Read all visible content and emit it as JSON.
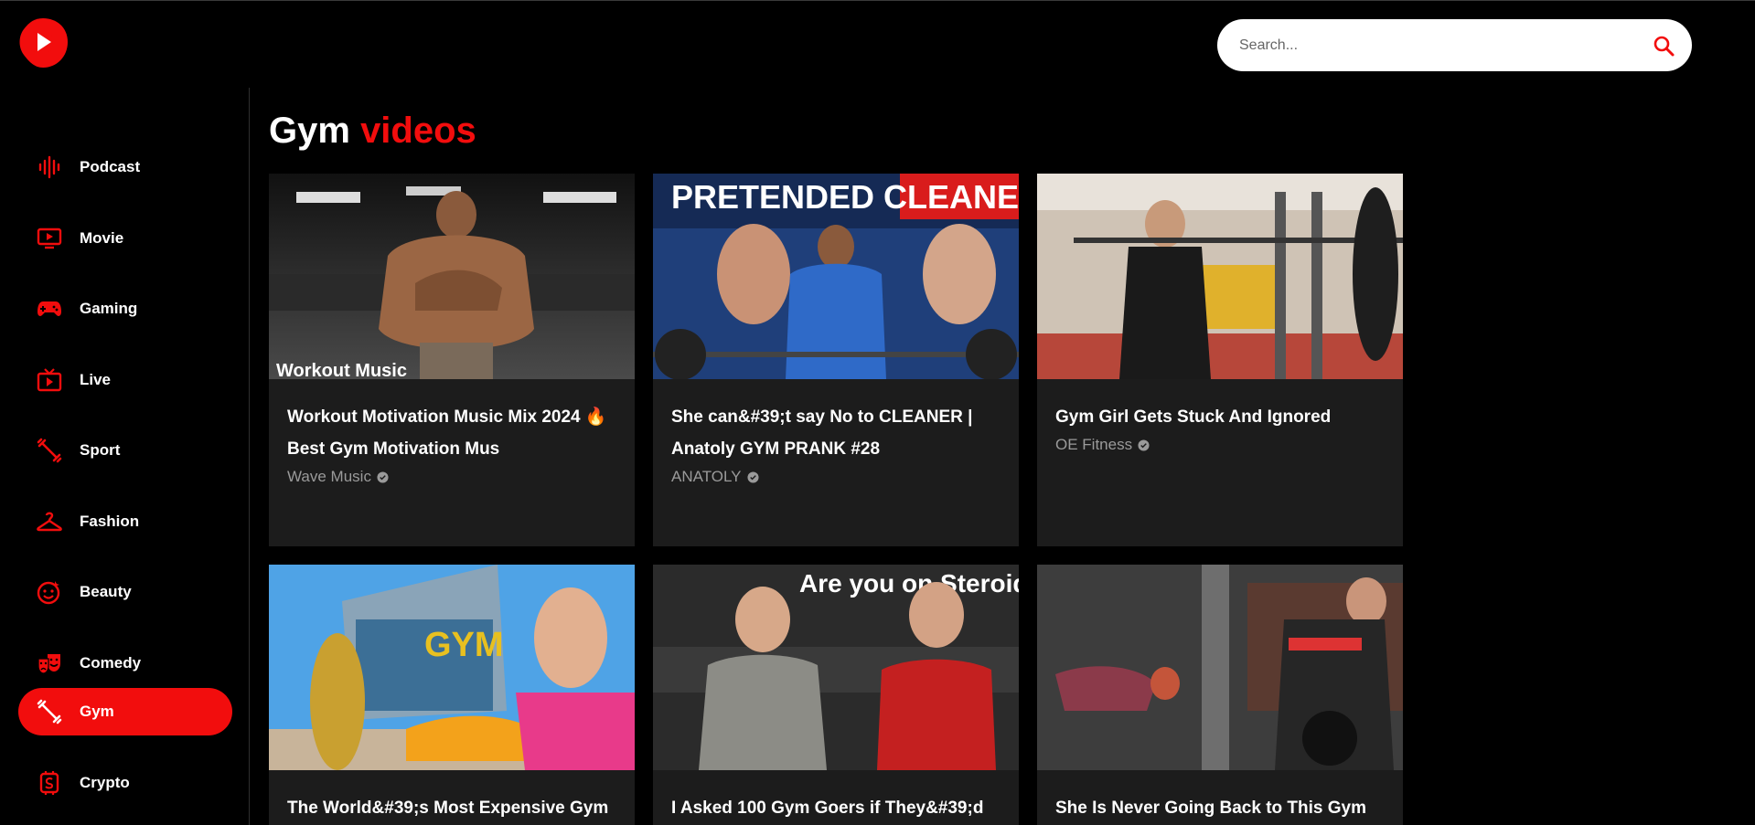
{
  "app": {
    "search_placeholder": "Search..."
  },
  "sidebar": {
    "items": [
      {
        "label": "Podcast",
        "icon": "podcast-icon",
        "active": false
      },
      {
        "label": "Movie",
        "icon": "movie-icon",
        "active": false
      },
      {
        "label": "Gaming",
        "icon": "gamepad-icon",
        "active": false
      },
      {
        "label": "Live",
        "icon": "live-tv-icon",
        "active": false
      },
      {
        "label": "Sport",
        "icon": "sport-icon",
        "active": false
      },
      {
        "label": "Fashion",
        "icon": "hanger-icon",
        "active": false
      },
      {
        "label": "Beauty",
        "icon": "beauty-icon",
        "active": false
      },
      {
        "label": "Comedy",
        "icon": "comedy-masks-icon",
        "active": false
      },
      {
        "label": "Gym",
        "icon": "dumbbell-icon",
        "active": true
      },
      {
        "label": "Crypto",
        "icon": "crypto-icon",
        "active": false
      }
    ]
  },
  "main": {
    "heading_primary": "Gym",
    "heading_accent": "videos",
    "videos": [
      {
        "title": "Workout Motivation Music Mix 2024 🔥 Best Gym Motivation Mus",
        "channel": "Wave Music",
        "verified": true,
        "thumb_text": "Workout Music"
      },
      {
        "title": "She can&#39;t say No to CLEANER | Anatoly GYM PRANK #28",
        "channel": "ANATOLY",
        "verified": true,
        "thumb_text": "PRETENDED CLEANER IN A GYM"
      },
      {
        "title": "Gym Girl Gets Stuck And Ignored",
        "channel": "OE Fitness",
        "verified": true,
        "thumb_text": ""
      },
      {
        "title": "The World&#39;s Most Expensive Gym",
        "channel": "",
        "verified": false,
        "thumb_text": "GYM"
      },
      {
        "title": "I Asked 100 Gym Goers if They&#39;d",
        "channel": "",
        "verified": false,
        "thumb_text": "Are you on Steroids? yes."
      },
      {
        "title": "She Is Never Going Back to This Gym",
        "channel": "",
        "verified": false,
        "thumb_text": ""
      }
    ]
  },
  "colors": {
    "accent": "#f20d0d",
    "background": "#000000",
    "card": "#1c1c1c",
    "muted_text": "#9a9a9a"
  }
}
